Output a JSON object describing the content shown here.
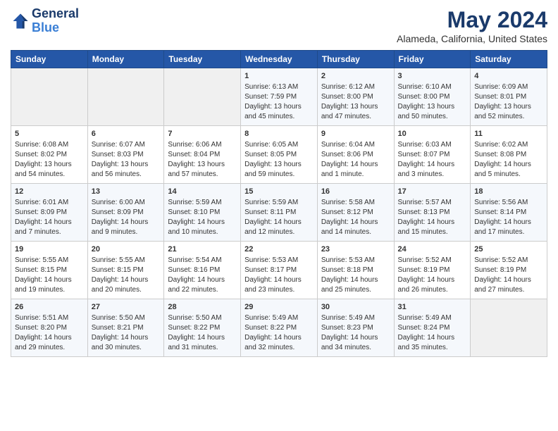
{
  "header": {
    "logo_line1": "General",
    "logo_line2": "Blue",
    "month_title": "May 2024",
    "location": "Alameda, California, United States"
  },
  "days_of_week": [
    "Sunday",
    "Monday",
    "Tuesday",
    "Wednesday",
    "Thursday",
    "Friday",
    "Saturday"
  ],
  "weeks": [
    [
      {
        "day": "",
        "sunrise": "",
        "sunset": "",
        "daylight": ""
      },
      {
        "day": "",
        "sunrise": "",
        "sunset": "",
        "daylight": ""
      },
      {
        "day": "",
        "sunrise": "",
        "sunset": "",
        "daylight": ""
      },
      {
        "day": "1",
        "sunrise": "Sunrise: 6:13 AM",
        "sunset": "Sunset: 7:59 PM",
        "daylight": "Daylight: 13 hours and 45 minutes."
      },
      {
        "day": "2",
        "sunrise": "Sunrise: 6:12 AM",
        "sunset": "Sunset: 8:00 PM",
        "daylight": "Daylight: 13 hours and 47 minutes."
      },
      {
        "day": "3",
        "sunrise": "Sunrise: 6:10 AM",
        "sunset": "Sunset: 8:00 PM",
        "daylight": "Daylight: 13 hours and 50 minutes."
      },
      {
        "day": "4",
        "sunrise": "Sunrise: 6:09 AM",
        "sunset": "Sunset: 8:01 PM",
        "daylight": "Daylight: 13 hours and 52 minutes."
      }
    ],
    [
      {
        "day": "5",
        "sunrise": "Sunrise: 6:08 AM",
        "sunset": "Sunset: 8:02 PM",
        "daylight": "Daylight: 13 hours and 54 minutes."
      },
      {
        "day": "6",
        "sunrise": "Sunrise: 6:07 AM",
        "sunset": "Sunset: 8:03 PM",
        "daylight": "Daylight: 13 hours and 56 minutes."
      },
      {
        "day": "7",
        "sunrise": "Sunrise: 6:06 AM",
        "sunset": "Sunset: 8:04 PM",
        "daylight": "Daylight: 13 hours and 57 minutes."
      },
      {
        "day": "8",
        "sunrise": "Sunrise: 6:05 AM",
        "sunset": "Sunset: 8:05 PM",
        "daylight": "Daylight: 13 hours and 59 minutes."
      },
      {
        "day": "9",
        "sunrise": "Sunrise: 6:04 AM",
        "sunset": "Sunset: 8:06 PM",
        "daylight": "Daylight: 14 hours and 1 minute."
      },
      {
        "day": "10",
        "sunrise": "Sunrise: 6:03 AM",
        "sunset": "Sunset: 8:07 PM",
        "daylight": "Daylight: 14 hours and 3 minutes."
      },
      {
        "day": "11",
        "sunrise": "Sunrise: 6:02 AM",
        "sunset": "Sunset: 8:08 PM",
        "daylight": "Daylight: 14 hours and 5 minutes."
      }
    ],
    [
      {
        "day": "12",
        "sunrise": "Sunrise: 6:01 AM",
        "sunset": "Sunset: 8:09 PM",
        "daylight": "Daylight: 14 hours and 7 minutes."
      },
      {
        "day": "13",
        "sunrise": "Sunrise: 6:00 AM",
        "sunset": "Sunset: 8:09 PM",
        "daylight": "Daylight: 14 hours and 9 minutes."
      },
      {
        "day": "14",
        "sunrise": "Sunrise: 5:59 AM",
        "sunset": "Sunset: 8:10 PM",
        "daylight": "Daylight: 14 hours and 10 minutes."
      },
      {
        "day": "15",
        "sunrise": "Sunrise: 5:59 AM",
        "sunset": "Sunset: 8:11 PM",
        "daylight": "Daylight: 14 hours and 12 minutes."
      },
      {
        "day": "16",
        "sunrise": "Sunrise: 5:58 AM",
        "sunset": "Sunset: 8:12 PM",
        "daylight": "Daylight: 14 hours and 14 minutes."
      },
      {
        "day": "17",
        "sunrise": "Sunrise: 5:57 AM",
        "sunset": "Sunset: 8:13 PM",
        "daylight": "Daylight: 14 hours and 15 minutes."
      },
      {
        "day": "18",
        "sunrise": "Sunrise: 5:56 AM",
        "sunset": "Sunset: 8:14 PM",
        "daylight": "Daylight: 14 hours and 17 minutes."
      }
    ],
    [
      {
        "day": "19",
        "sunrise": "Sunrise: 5:55 AM",
        "sunset": "Sunset: 8:15 PM",
        "daylight": "Daylight: 14 hours and 19 minutes."
      },
      {
        "day": "20",
        "sunrise": "Sunrise: 5:55 AM",
        "sunset": "Sunset: 8:15 PM",
        "daylight": "Daylight: 14 hours and 20 minutes."
      },
      {
        "day": "21",
        "sunrise": "Sunrise: 5:54 AM",
        "sunset": "Sunset: 8:16 PM",
        "daylight": "Daylight: 14 hours and 22 minutes."
      },
      {
        "day": "22",
        "sunrise": "Sunrise: 5:53 AM",
        "sunset": "Sunset: 8:17 PM",
        "daylight": "Daylight: 14 hours and 23 minutes."
      },
      {
        "day": "23",
        "sunrise": "Sunrise: 5:53 AM",
        "sunset": "Sunset: 8:18 PM",
        "daylight": "Daylight: 14 hours and 25 minutes."
      },
      {
        "day": "24",
        "sunrise": "Sunrise: 5:52 AM",
        "sunset": "Sunset: 8:19 PM",
        "daylight": "Daylight: 14 hours and 26 minutes."
      },
      {
        "day": "25",
        "sunrise": "Sunrise: 5:52 AM",
        "sunset": "Sunset: 8:19 PM",
        "daylight": "Daylight: 14 hours and 27 minutes."
      }
    ],
    [
      {
        "day": "26",
        "sunrise": "Sunrise: 5:51 AM",
        "sunset": "Sunset: 8:20 PM",
        "daylight": "Daylight: 14 hours and 29 minutes."
      },
      {
        "day": "27",
        "sunrise": "Sunrise: 5:50 AM",
        "sunset": "Sunset: 8:21 PM",
        "daylight": "Daylight: 14 hours and 30 minutes."
      },
      {
        "day": "28",
        "sunrise": "Sunrise: 5:50 AM",
        "sunset": "Sunset: 8:22 PM",
        "daylight": "Daylight: 14 hours and 31 minutes."
      },
      {
        "day": "29",
        "sunrise": "Sunrise: 5:49 AM",
        "sunset": "Sunset: 8:22 PM",
        "daylight": "Daylight: 14 hours and 32 minutes."
      },
      {
        "day": "30",
        "sunrise": "Sunrise: 5:49 AM",
        "sunset": "Sunset: 8:23 PM",
        "daylight": "Daylight: 14 hours and 34 minutes."
      },
      {
        "day": "31",
        "sunrise": "Sunrise: 5:49 AM",
        "sunset": "Sunset: 8:24 PM",
        "daylight": "Daylight: 14 hours and 35 minutes."
      },
      {
        "day": "",
        "sunrise": "",
        "sunset": "",
        "daylight": ""
      }
    ]
  ]
}
